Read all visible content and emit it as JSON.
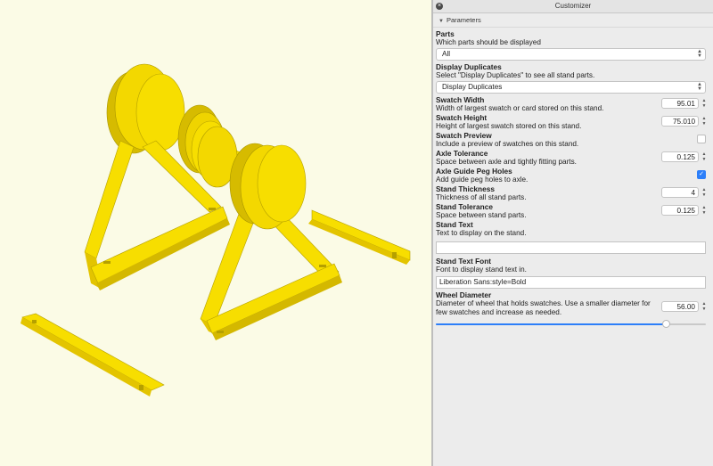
{
  "viewport": {
    "model": "swatch-stand",
    "model_color": "#f7de00",
    "shade_color": "#e3c400",
    "dark_color": "#b5a000",
    "background": "#fbfbe6"
  },
  "panel": {
    "window_title": "Customizer",
    "section_title": "Parameters",
    "parameters": {
      "parts": {
        "name": "Parts",
        "description": "Which parts should be displayed",
        "value": "All"
      },
      "display_duplicates": {
        "name": "Display Duplicates",
        "description": "Select \"Display Duplicates\" to see all stand parts.",
        "value": "Display Duplicates"
      },
      "swatch_width": {
        "name": "Swatch Width",
        "description": "Width of largest swatch or card stored on this stand.",
        "value": "95.01"
      },
      "swatch_height": {
        "name": "Swatch Height",
        "description": "Height of largest swatch stored on this stand.",
        "value": "75.010"
      },
      "swatch_preview": {
        "name": "Swatch Preview",
        "description": "Include a preview of swatches on this stand.",
        "checked": false
      },
      "axle_tolerance": {
        "name": "Axle Tolerance",
        "description": "Space between axle and tightly fitting parts.",
        "value": "0.125"
      },
      "axle_guide_peg_holes": {
        "name": "Axle Guide Peg Holes",
        "description": "Add guide peg holes to axle.",
        "checked": true
      },
      "stand_thickness": {
        "name": "Stand Thickness",
        "description": "Thickness of all stand parts.",
        "value": "4"
      },
      "stand_tolerance": {
        "name": "Stand Tolerance",
        "description": "Space between stand parts.",
        "value": "0.125"
      },
      "stand_text": {
        "name": "Stand Text",
        "description": "Text to display on the stand.",
        "value": ""
      },
      "stand_text_font": {
        "name": "Stand Text Font",
        "description": "Font to display stand text in.",
        "value": "Liberation Sans:style=Bold"
      },
      "wheel_diameter": {
        "name": "Wheel Diameter",
        "description": "Diameter of wheel that holds swatches. Use a smaller diameter for few swatches and increase as needed.",
        "value": "56.00",
        "slider_fraction": 0.85
      }
    },
    "accent_color": "#2d7ff9"
  }
}
